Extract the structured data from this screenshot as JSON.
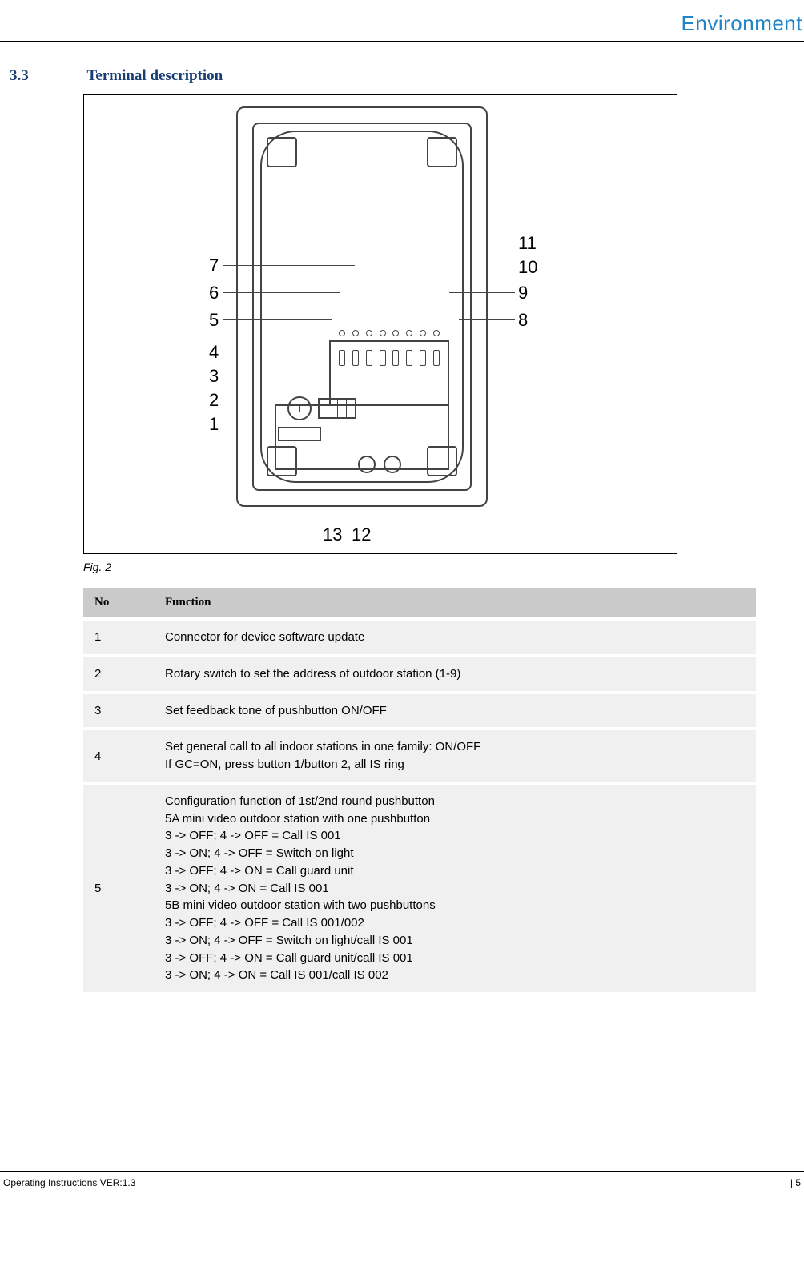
{
  "brand": "Environment",
  "section": {
    "number": "3.3",
    "title": "Terminal description"
  },
  "figure_caption": "Fig. 2",
  "callouts": {
    "l1": "1",
    "l2": "2",
    "l3": "3",
    "l4": "4",
    "l5": "5",
    "l6": "6",
    "l7": "7",
    "r8": "8",
    "r9": "9",
    "r10": "10",
    "r11": "11",
    "b12": "12",
    "b13": "13"
  },
  "table": {
    "headers": {
      "no": "No",
      "fn": "Function"
    },
    "rows": [
      {
        "no": "1",
        "fn": "Connector for device software update"
      },
      {
        "no": "2",
        "fn": "Rotary switch to set the address of outdoor station (1-9)"
      },
      {
        "no": "3",
        "fn": "Set feedback tone of pushbutton ON/OFF"
      },
      {
        "no": "4",
        "fn": "Set general call to all indoor stations in one family: ON/OFF\nIf GC=ON, press button 1/button 2, all IS ring"
      },
      {
        "no": "5",
        "fn": "Configuration function of 1st/2nd round pushbutton\n5A mini video outdoor station with one pushbutton\n3 -> OFF; 4 -> OFF = Call IS 001\n3 -> ON; 4 -> OFF = Switch on light\n3 -> OFF; 4 -> ON = Call guard unit\n3 -> ON; 4 -> ON = Call IS 001\n5B mini video outdoor station with two pushbuttons\n3 -> OFF; 4 -> OFF = Call IS 001/002\n3 -> ON; 4 -> OFF = Switch on light/call IS 001\n3 -> OFF; 4 -> ON = Call guard unit/call IS 001\n3 -> ON; 4 -> ON = Call IS 001/call IS 002"
      }
    ]
  },
  "footer": {
    "left": "Operating Instructions VER:1.3",
    "right": "5"
  }
}
